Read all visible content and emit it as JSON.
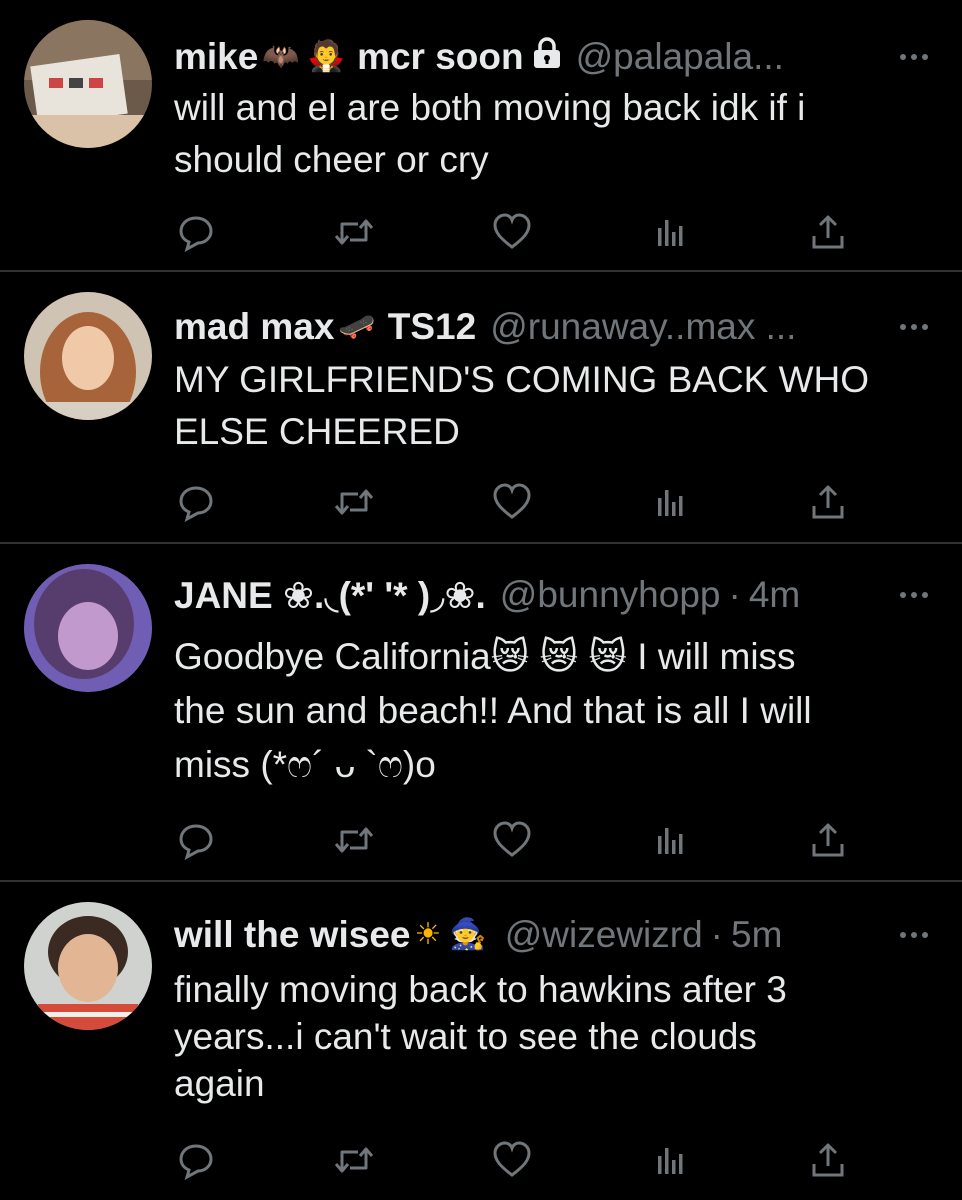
{
  "tweets": [
    {
      "name": "mike",
      "name_emojis": [
        "🦇",
        "🧛"
      ],
      "name_suffix": "mcr soon",
      "protected": true,
      "handle": "@palapala...",
      "time": "",
      "text_lines": [
        "will and el are both moving back idk if i",
        "should cheer or cry"
      ],
      "avatar_icon": "avatar-photo"
    },
    {
      "name": "mad max",
      "name_emojis": [
        "🛹"
      ],
      "name_suffix": "TS12",
      "protected": false,
      "handle": "@runaway..max ...",
      "time": "",
      "text_lines": [
        "MY GIRLFRIEND'S COMING BACK WHO",
        "ELSE CHEERED"
      ],
      "avatar_icon": "avatar-photo"
    },
    {
      "name": "JANE ❀.◟(*' '* )◞❀.",
      "name_emojis": [],
      "name_suffix": "",
      "protected": false,
      "handle": "@bunnyhopp",
      "time": "4m",
      "text_lines": [
        "Goodbye California😿 😿 😿  I will miss",
        "the sun and beach!! And that is all I will",
        "miss (*ෆ´ ᴗ `ෆ)o"
      ],
      "avatar_icon": "avatar-photo"
    },
    {
      "name": "will the wisee",
      "name_emojis": [
        "☀",
        "🧙"
      ],
      "name_suffix": "",
      "protected": false,
      "handle": "@wizewizrd",
      "time": "5m",
      "text_lines": [
        "finally moving back to hawkins after 3",
        "years...i can't wait to see the clouds",
        "again"
      ],
      "avatar_icon": "avatar-photo"
    }
  ],
  "icons": {
    "reply": "reply-icon",
    "retweet": "retweet-icon",
    "like": "heart-icon",
    "views": "views-icon",
    "share": "share-icon",
    "more": "more-icon",
    "lock": "lock-icon"
  },
  "colors": {
    "background": "#000000",
    "text": "#e7e9ea",
    "secondary": "#71767b",
    "divider": "#2f3336"
  }
}
